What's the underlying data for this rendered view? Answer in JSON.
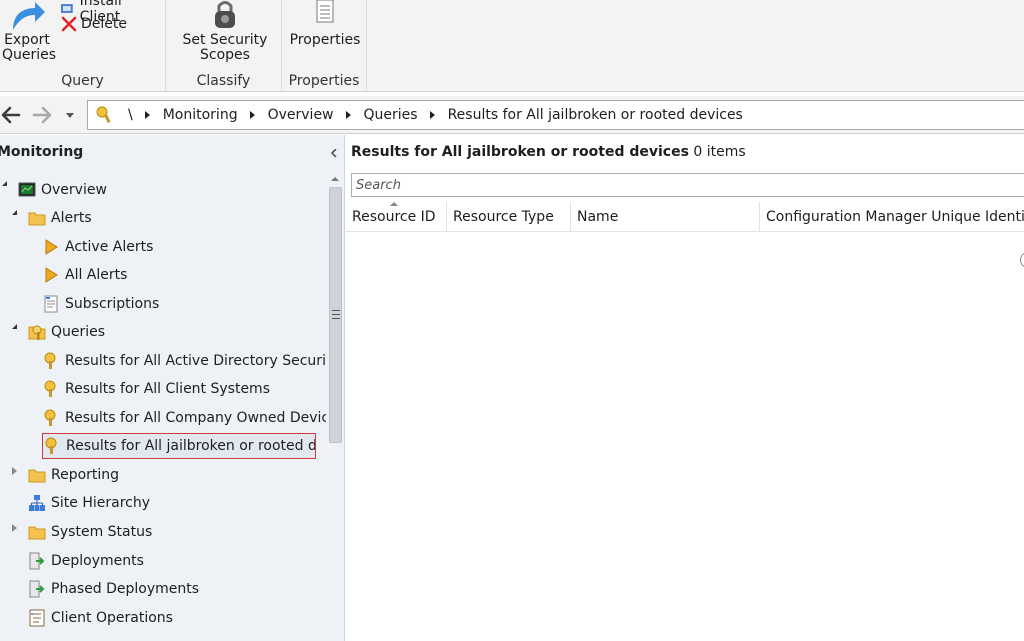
{
  "ribbon": {
    "query_group": {
      "label": "Query",
      "export_queries": "Export\nQueries",
      "install_client": "Install Client",
      "delete": "Delete"
    },
    "classify_group": {
      "label": "Classify",
      "set_security_scopes": "Set Security\nScopes"
    },
    "properties_group": {
      "label": "Properties",
      "properties": "Properties"
    }
  },
  "addressbar": {
    "root": "\\",
    "crumbs": [
      "Monitoring",
      "Overview",
      "Queries",
      "Results for All jailbroken or rooted devices"
    ]
  },
  "navpane": {
    "title": "Monitoring",
    "tree": [
      {
        "label": "Overview",
        "icon": "overview-icon",
        "expander": "open"
      },
      {
        "label": "Alerts",
        "icon": "folder-icon",
        "expander": "open"
      },
      {
        "label": "Active Alerts",
        "icon": "alert-icon"
      },
      {
        "label": "All Alerts",
        "icon": "alert-icon"
      },
      {
        "label": "Subscriptions",
        "icon": "subscription-icon"
      },
      {
        "label": "Queries",
        "icon": "query-folder-icon",
        "expander": "open"
      },
      {
        "label": "Results for All Active Directory Security G",
        "icon": "query-icon"
      },
      {
        "label": "Results for All Client Systems",
        "icon": "query-icon"
      },
      {
        "label": "Results for All Company Owned Devices",
        "icon": "query-icon"
      },
      {
        "label": "Results for All jailbroken or rooted device",
        "icon": "query-icon",
        "selected": true
      },
      {
        "label": "Reporting",
        "icon": "folder-icon",
        "expander": "closed"
      },
      {
        "label": "Site Hierarchy",
        "icon": "hierarchy-icon"
      },
      {
        "label": "System Status",
        "icon": "folder-icon",
        "expander": "closed"
      },
      {
        "label": "Deployments",
        "icon": "deployment-icon"
      },
      {
        "label": "Phased Deployments",
        "icon": "deployment-icon"
      },
      {
        "label": "Client Operations",
        "icon": "client-operations-icon"
      }
    ]
  },
  "results": {
    "title": "Results for All jailbroken or rooted devices",
    "count": "0 items",
    "search_placeholder": "Search",
    "columns": [
      "Resource ID",
      "Resource Type",
      "Name",
      "Configuration Manager Unique Identifier"
    ]
  },
  "colors": {
    "ribbon_bg": "#f3f3f3",
    "nav_bg": "#eef1f6",
    "selection_outline": "#d43a3a",
    "folder": "#f2c14e",
    "alert": "#f0a81c"
  }
}
